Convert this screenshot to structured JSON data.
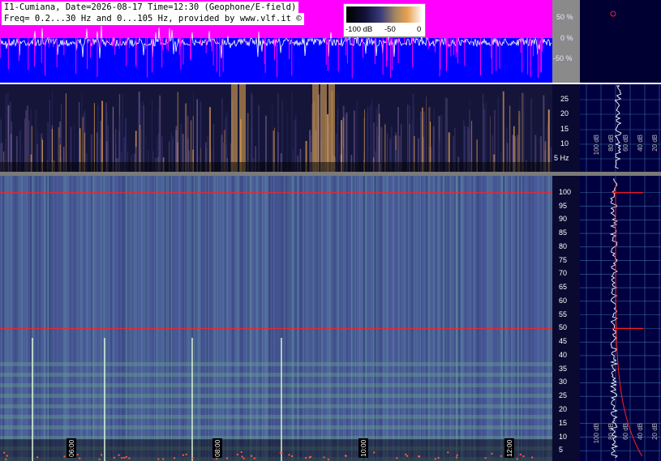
{
  "header": {
    "line1": "I1-Cumiana, Date=2026-08-17 Time=12:30 (Geophone/E-field)",
    "line2": "Freq= 0.2...30 Hz and 0...105 Hz, provided by www.vlf.it ©"
  },
  "colorbar": {
    "min_label": "-100 dB",
    "mid_label": "-50",
    "max_label": "0"
  },
  "colors": {
    "magenta": "#ff00ff",
    "blue": "#0000ff",
    "redline": "#ff2020",
    "waveform": "#ffffff"
  },
  "chart_data": [
    {
      "type": "area",
      "name": "waveform",
      "yticks": [
        "50 %",
        "0 %",
        "-50 %"
      ],
      "ylim": [
        -100,
        100
      ]
    },
    {
      "type": "heatmap",
      "name": "low-frequency spectrogram",
      "ylabel_unit": "Hz",
      "yticks": [
        "25",
        "20",
        "15",
        "10",
        "5 Hz"
      ],
      "ylim": [
        0,
        30
      ],
      "bp_labels": [
        "100 dB",
        "80 dB",
        "60 dB",
        "40 dB",
        "20 dB"
      ]
    },
    {
      "type": "heatmap",
      "name": "0-105 Hz spectrogram",
      "yticks": [
        "100",
        "95",
        "90",
        "85",
        "80",
        "75",
        "70",
        "65",
        "60",
        "55",
        "50",
        "45",
        "40",
        "35",
        "30",
        "25",
        "20",
        "15",
        "10",
        "5"
      ],
      "ylim": [
        0,
        105
      ],
      "hlines_hz": [
        100,
        50
      ],
      "time_labels": [
        "06:00",
        "08:00",
        "10:00",
        "12:00"
      ],
      "bp_labels": [
        "100 dB",
        "80 dB",
        "60 dB",
        "40 dB",
        "20 dB"
      ]
    }
  ]
}
